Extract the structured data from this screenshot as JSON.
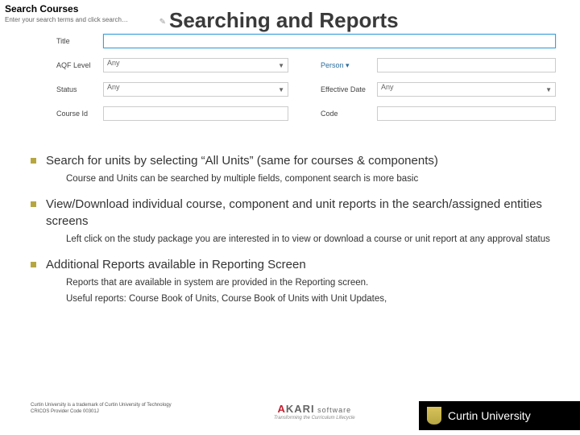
{
  "heading": "Searching and Reports",
  "searchCourses": {
    "title": "Search Courses",
    "subtitle": "Enter your search terms and click search…"
  },
  "form": {
    "titleLabel": "Title",
    "aqfLabel": "AQF Level",
    "aqfValue": "Any",
    "personLabel": "Person ",
    "personCaret": "▾",
    "statusLabel": "Status",
    "statusValue": "Any",
    "effDateLabel": "Effective Date",
    "effDateValue": "Any",
    "courseIdLabel": "Course Id",
    "codeLabel": "Code"
  },
  "bullets": [
    {
      "main": "Search for units by selecting “All Units” (same for courses & components)",
      "subs": [
        "Course and Units can be searched by multiple fields, component search is more basic"
      ]
    },
    {
      "main": "View/Download individual course, component and unit reports in the search/assigned entities screens",
      "subs": [
        "Left click on the study package you are interested in to view or download a course or unit report at any approval status"
      ]
    },
    {
      "main": "Additional Reports available in Reporting Screen",
      "subs": [
        "Reports that are available in system are provided in the Reporting screen.",
        "Useful reports: Course Book of Units, Course Book of Units with Unit Updates,"
      ]
    }
  ],
  "footer": {
    "legal1": "Curtin University is a trademark of Curtin University of Technology",
    "legal2": "CRICOS Provider Code 00301J",
    "akariName1": "A",
    "akariName2": "KARI",
    "akariSoft": " software",
    "akariTag": "Transforming the Curriculum Lifecycle",
    "curtin": "Curtin University"
  }
}
